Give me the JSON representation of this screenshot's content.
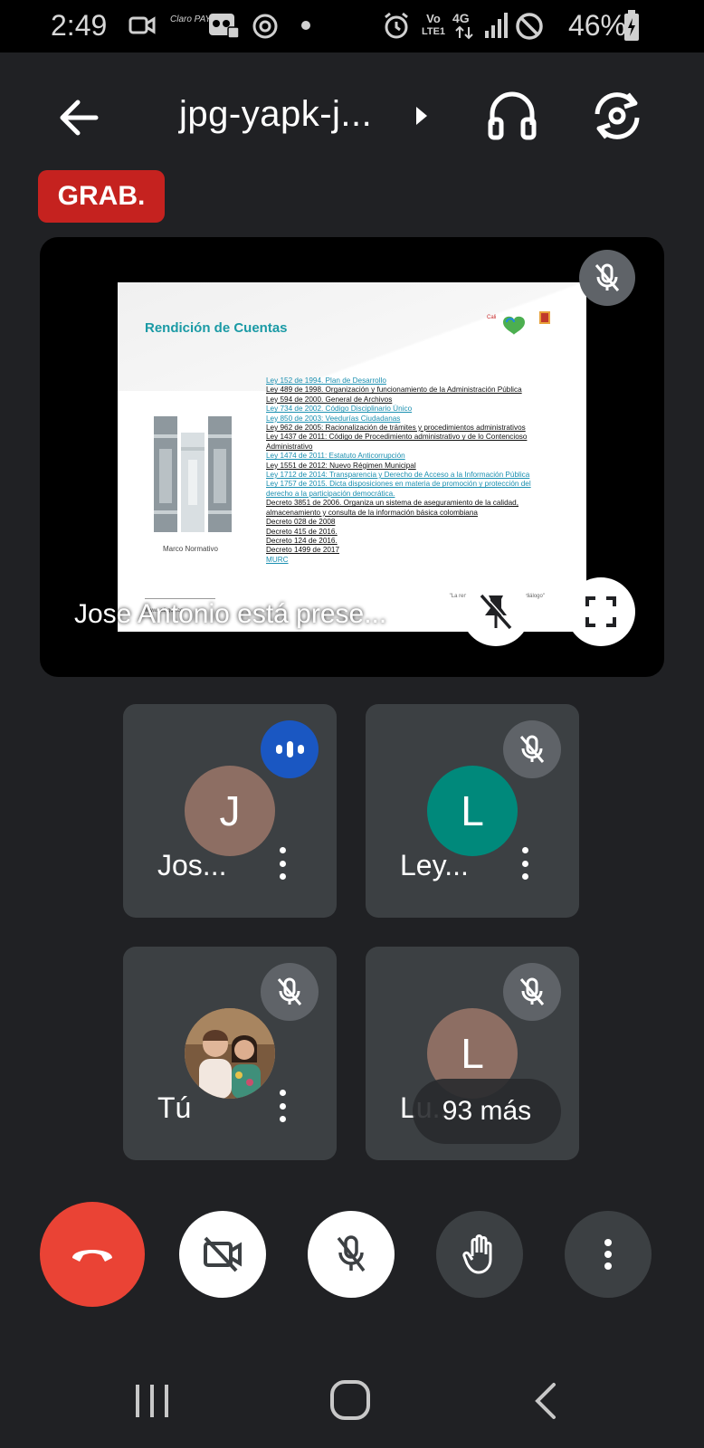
{
  "status_bar": {
    "time": "2:49",
    "carrier": "Claro PAY",
    "network_top": "Vo",
    "network_bottom": "LTE1",
    "network_gen": "4G",
    "battery": "46%"
  },
  "header": {
    "meeting_code": "jpg-yapk-j...",
    "recording_badge": "GRAB."
  },
  "presentation": {
    "presenter_label": "Jose Antonio está prese...",
    "slide": {
      "title": "Rendición de Cuentas",
      "caption": "Marco Normativo",
      "logo_text": "Cali",
      "footer_url": "www.cali.gov.co",
      "footer_quote": "\"La rendición de cuentas es un diálogo\"",
      "laws": [
        {
          "text": "Ley 152 de 1994. Plan de Desarrollo",
          "style": "link"
        },
        {
          "text": "Ley 489 de 1998. Organización y funcionamiento de la Administración Pública",
          "style": "plain"
        },
        {
          "text": "Ley 594 de 2000. General de Archivos",
          "style": "plain"
        },
        {
          "text": "Ley 734 de 2002. Código Disciplinario Único",
          "style": "link"
        },
        {
          "text": "Ley 850 de 2003: Veedurías Ciudadanas",
          "style": "link"
        },
        {
          "text": "Ley 962 de 2005: Racionalización de trámites y procedimientos administrativos",
          "style": "plain"
        },
        {
          "text": "Ley 1437 de 2011: Código de Procedimiento administrativo y de lo Contencioso",
          "style": "plain"
        },
        {
          "text": "Administrativo",
          "style": "plain"
        },
        {
          "text": "Ley 1474 de 2011: Estatuto Anticorrupción",
          "style": "link"
        },
        {
          "text": "Ley 1551 de 2012: Nuevo Régimen Municipal",
          "style": "plain"
        },
        {
          "text": "Ley 1712 de 2014: Transparencia y Derecho de Acceso a la Información Pública",
          "style": "link"
        },
        {
          "text": "Ley 1757 de 2015. Dicta disposiciones en materia de promoción y protección del",
          "style": "link"
        },
        {
          "text": "derecho a la participación democrática.",
          "style": "link"
        },
        {
          "text": "Decreto 3851 de 2006. Organiza un sistema de aseguramiento de la calidad,",
          "style": "plain"
        },
        {
          "text": "almacenamiento y consulta de la información básica colombiana",
          "style": "plain"
        },
        {
          "text": "Decreto 028 de 2008",
          "style": "plain"
        },
        {
          "text": "Decreto 415 de 2016.",
          "style": "plain"
        },
        {
          "text": "Decreto 124 de 2016.",
          "style": "plain"
        },
        {
          "text": "Decreto 1499 de 2017",
          "style": "plain"
        },
        {
          "text": "MURC",
          "style": "link"
        }
      ]
    }
  },
  "participants": [
    {
      "initial": "J",
      "name": "Jos...",
      "avatar_color": "#8d6e63",
      "status": "speaking"
    },
    {
      "initial": "L",
      "name": "Ley...",
      "avatar_color": "#00897b",
      "status": "muted"
    },
    {
      "initial": "",
      "name": "Tú",
      "avatar_color": "#c9a88a",
      "status": "muted"
    },
    {
      "initial": "L",
      "name": "Lu...",
      "avatar_color": "#8d6e63",
      "status": "muted"
    }
  ],
  "more_participants": "93 más",
  "colors": {
    "end_call": "#ea4335",
    "recording": "#c5221f",
    "speaking": "#1a57c2",
    "background": "#202124",
    "tile": "#3c4043"
  },
  "icons": [
    "back-arrow-icon",
    "chevron-right-icon",
    "headphones-icon",
    "switch-camera-icon",
    "mic-off-icon",
    "unpin-icon",
    "fullscreen-icon",
    "end-call-icon",
    "camera-off-icon",
    "raise-hand-icon",
    "more-vert-icon"
  ]
}
